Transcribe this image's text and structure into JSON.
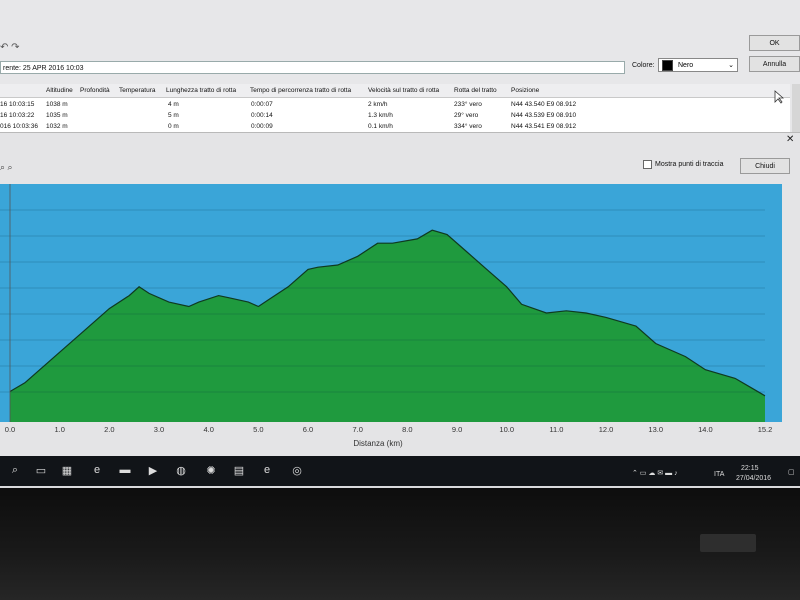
{
  "window": {
    "title_field": "rente: 25 APR 2016 10:03",
    "colore_label": "Colore:",
    "colore_value": "Nero",
    "ok_label": "OK",
    "annulla_label": "Annulla"
  },
  "table": {
    "headers": [
      "Altitudine",
      "Profondità",
      "Temperatura",
      "Lunghezza tratto di rotta",
      "Tempo di percorrenza tratto di rotta",
      "Velocità sul tratto di rotta",
      "Rotta del tratto",
      "Posizione"
    ],
    "rows": [
      {
        "time": "16 10:03:15",
        "alt": "1038 m",
        "len": "4 m",
        "dur": "0:00:07",
        "speed": "2 km/h",
        "course": "233° vero",
        "pos": "N44 43.540 E9 08.912"
      },
      {
        "time": "16 10:03:22",
        "alt": "1035 m",
        "len": "5 m",
        "dur": "0:00:14",
        "speed": "1.3 km/h",
        "course": "29° vero",
        "pos": "N44 43.539 E9 08.910"
      },
      {
        "time": "016 10:03:36",
        "alt": "1032 m",
        "len": "0 m",
        "dur": "0:00:09",
        "speed": "0.1 km/h",
        "course": "334° vero",
        "pos": "N44 43.541 E9 08.912"
      }
    ]
  },
  "profile": {
    "close_glyph": "✕",
    "show_points_label": "Mostra punti di traccia",
    "chiudi_label": "Chiudi"
  },
  "chart_data": {
    "type": "area",
    "xlabel": "Distanza  (km)",
    "xlim": [
      0,
      15.2
    ],
    "x_ticks": [
      "0.0",
      "1.0",
      "2.0",
      "3.0",
      "4.0",
      "5.0",
      "6.0",
      "7.0",
      "8.0",
      "9.0",
      "10.0",
      "11.0",
      "12.0",
      "13.0",
      "14.0",
      "15.2"
    ],
    "x": [
      0,
      0.3,
      0.6,
      1.0,
      1.5,
      2.0,
      2.4,
      2.6,
      2.8,
      3.2,
      3.6,
      3.8,
      4.2,
      4.4,
      4.8,
      5.0,
      5.2,
      5.6,
      6.0,
      6.2,
      6.6,
      7.0,
      7.4,
      7.7,
      8.2,
      8.5,
      8.8,
      9.2,
      9.6,
      10.0,
      10.3,
      10.8,
      11.2,
      11.6,
      12.0,
      12.6,
      13.0,
      13.6,
      14.0,
      14.6,
      15.2
    ],
    "y": [
      0.14,
      0.18,
      0.24,
      0.32,
      0.42,
      0.52,
      0.58,
      0.62,
      0.59,
      0.55,
      0.53,
      0.55,
      0.58,
      0.57,
      0.55,
      0.53,
      0.56,
      0.62,
      0.7,
      0.71,
      0.72,
      0.76,
      0.82,
      0.82,
      0.84,
      0.88,
      0.86,
      0.78,
      0.7,
      0.62,
      0.54,
      0.5,
      0.51,
      0.5,
      0.48,
      0.44,
      0.36,
      0.3,
      0.24,
      0.2,
      0.12
    ],
    "colors": {
      "sky": "#3aa5d8",
      "fill": "#1f9a3e",
      "line": "#0f3a20"
    },
    "grid": true
  },
  "taskbar": {
    "clock_time": "22:15",
    "clock_date": "27/04/2016",
    "lang": "ITA",
    "icons": [
      "search-icon",
      "task-view-icon",
      "store-icon",
      "edge-icon",
      "folder-icon",
      "media-icon",
      "globe-icon",
      "settings-icon",
      "photos-icon",
      "ie-icon",
      "chrome-icon"
    ]
  }
}
